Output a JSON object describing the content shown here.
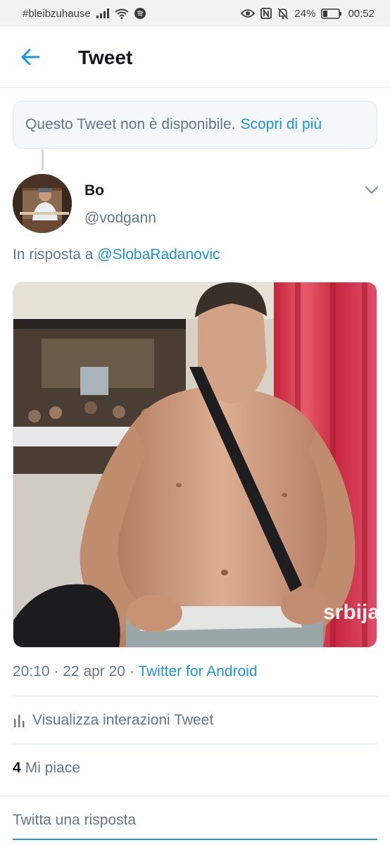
{
  "status_bar": {
    "hashtag": "#bleibzuhause",
    "battery": "24%",
    "time": "00:52"
  },
  "header": {
    "title": "Tweet",
    "back_icon": "arrow-left-icon"
  },
  "unavailable": {
    "message": "Questo Tweet non è disponibile.",
    "link": "Scopri di più"
  },
  "tweet": {
    "author_name": "Bo",
    "author_handle": "@vodgann",
    "reply_prefix": "In risposta a",
    "reply_mention": "@SlobaRadanovic",
    "media_caption": "srbija",
    "time": "20:10",
    "date": "22 apr 20",
    "source": "Twitter for Android",
    "separator": "·"
  },
  "actions": {
    "interactions_label": "Visualizza interazioni Tweet",
    "likes_count": "4",
    "likes_label": "Mi piace"
  },
  "composer": {
    "placeholder": "Twitta una risposta"
  },
  "colors": {
    "accent": "#1b95e0",
    "text_secondary": "#657786",
    "border": "#e1e8ed"
  }
}
